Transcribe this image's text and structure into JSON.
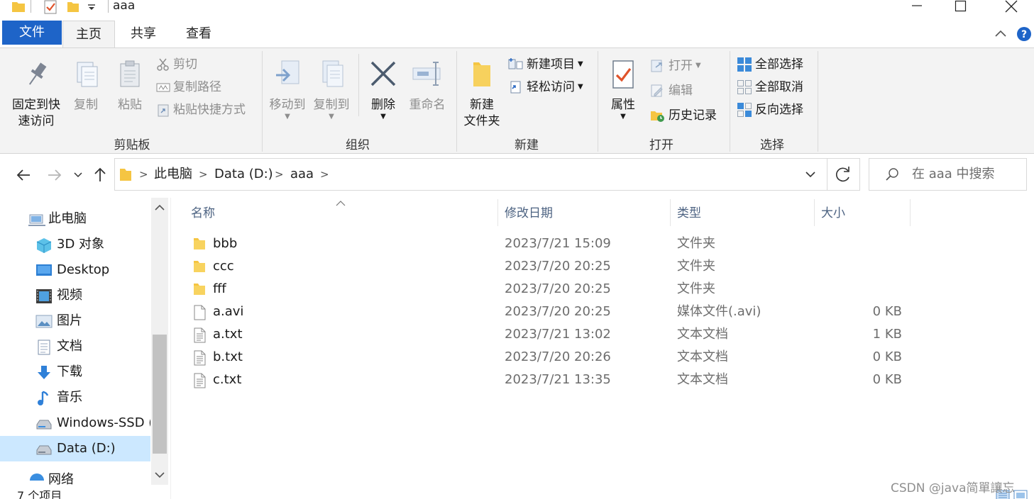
{
  "window": {
    "title": "aaa"
  },
  "ribbon_tabs": [
    "文件",
    "主页",
    "共享",
    "查看"
  ],
  "ribbon": {
    "clipboard": {
      "pin_label_line1": "固定到快",
      "pin_label_line2": "速访问",
      "copy_label": "复制",
      "paste_label": "粘贴",
      "cut_label": "剪切",
      "copy_path_label": "复制路径",
      "paste_shortcut_label": "粘贴快捷方式",
      "group_label": "剪贴板"
    },
    "organize": {
      "move_to_label": "移动到",
      "copy_to_label": "复制到",
      "delete_label": "删除",
      "rename_label": "重命名",
      "group_label": "组织"
    },
    "new": {
      "new_folder_line1": "新建",
      "new_folder_line2": "文件夹",
      "new_item_label": "新建项目",
      "easy_access_label": "轻松访问",
      "group_label": "新建"
    },
    "open": {
      "properties_label": "属性",
      "open_label": "打开",
      "edit_label": "编辑",
      "history_label": "历史记录",
      "group_label": "打开"
    },
    "select": {
      "select_all_label": "全部选择",
      "select_none_label": "全部取消",
      "invert_label": "反向选择",
      "group_label": "选择"
    }
  },
  "address": {
    "crumbs": [
      "此电脑",
      "Data (D:)",
      "aaa"
    ],
    "search_placeholder": "在 aaa 中搜索"
  },
  "nav_pane": {
    "items": [
      {
        "label": "此电脑",
        "icon": "computer-icon"
      },
      {
        "label": "3D 对象",
        "icon": "3d-objects-icon"
      },
      {
        "label": "Desktop",
        "icon": "desktop-icon"
      },
      {
        "label": "视频",
        "icon": "video-icon"
      },
      {
        "label": "图片",
        "icon": "pictures-icon"
      },
      {
        "label": "文档",
        "icon": "documents-icon"
      },
      {
        "label": "下载",
        "icon": "download-icon"
      },
      {
        "label": "音乐",
        "icon": "music-icon"
      },
      {
        "label": "Windows-SSD (",
        "icon": "drive-icon"
      },
      {
        "label": "Data (D:)",
        "icon": "drive-icon",
        "selected": true
      },
      {
        "label": "网络",
        "icon": "network-icon"
      }
    ]
  },
  "file_list": {
    "columns": [
      "名称",
      "修改日期",
      "类型",
      "大小"
    ],
    "rows": [
      {
        "name": "bbb",
        "date": "2023/7/21 15:09",
        "type": "文件夹",
        "size": "",
        "icon": "folder-icon"
      },
      {
        "name": "ccc",
        "date": "2023/7/20 20:25",
        "type": "文件夹",
        "size": "",
        "icon": "folder-icon"
      },
      {
        "name": "fff",
        "date": "2023/7/20 20:25",
        "type": "文件夹",
        "size": "",
        "icon": "folder-icon"
      },
      {
        "name": "a.avi",
        "date": "2023/7/20 20:25",
        "type": "媒体文件(.avi)",
        "size": "0 KB",
        "icon": "blank-file-icon"
      },
      {
        "name": "a.txt",
        "date": "2023/7/21 13:02",
        "type": "文本文档",
        "size": "1 KB",
        "icon": "text-file-icon"
      },
      {
        "name": "b.txt",
        "date": "2023/7/20 20:26",
        "type": "文本文档",
        "size": "0 KB",
        "icon": "text-file-icon"
      },
      {
        "name": "c.txt",
        "date": "2023/7/21 13:35",
        "type": "文本文档",
        "size": "0 KB",
        "icon": "text-file-icon"
      }
    ]
  },
  "status": {
    "item_count": "7 个项目"
  },
  "watermark": "CSDN @java简單讓忘",
  "colors": {
    "accent": "#1e64c8",
    "folder": "#f5c542",
    "selected": "#cce8ff",
    "ribbon_bg": "#f3f3f3"
  }
}
